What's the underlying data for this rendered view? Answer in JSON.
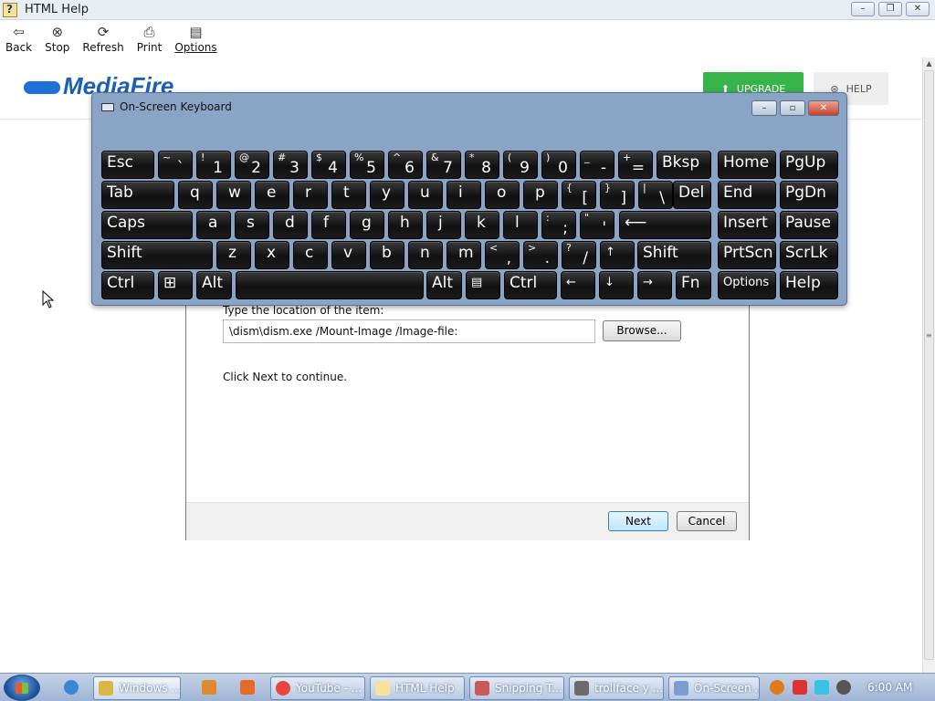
{
  "help_window": {
    "title": "HTML Help",
    "controls": [
      "–",
      "❐",
      "✕"
    ]
  },
  "toolbar": {
    "back": "Back",
    "stop": "Stop",
    "refresh": "Refresh",
    "print": "Print",
    "options": "Options"
  },
  "mediafire": {
    "logo_text": "MediaFire",
    "upgrade_label": "UPGRADE",
    "help_label": "HELP",
    "colors": {
      "brand": "#1c5fb5",
      "upgrade": "#37b34a"
    }
  },
  "wizard": {
    "prompt": "Type the location of the item:",
    "location_value": "\\dism\\dism.exe /Mount-Image /Image-file:",
    "browse_label": "Browse...",
    "continue_text": "Click Next to continue.",
    "next_label": "Next",
    "cancel_label": "Cancel"
  },
  "osk": {
    "title": "On-Screen Keyboard",
    "keys": {
      "esc": "Esc",
      "bksp": "Bksp",
      "home": "Home",
      "pgup": "PgUp",
      "tab": "Tab",
      "del": "Del",
      "end": "End",
      "pgdn": "PgDn",
      "caps": "Caps",
      "insert": "Insert",
      "pause": "Pause",
      "shift_left": "Shift",
      "shift_right": "Shift",
      "prtscn": "PrtScn",
      "scrlk": "ScrLk",
      "ctrl_left": "Ctrl",
      "alt_left": "Alt",
      "alt_right": "Alt",
      "ctrl_right": "Ctrl",
      "fn": "Fn",
      "options": "Options",
      "help": "Help"
    },
    "number_row": [
      {
        "s": "~",
        "b": "`"
      },
      {
        "s": "!",
        "b": "1"
      },
      {
        "s": "@",
        "b": "2"
      },
      {
        "s": "#",
        "b": "3"
      },
      {
        "s": "$",
        "b": "4"
      },
      {
        "s": "%",
        "b": "5"
      },
      {
        "s": "^",
        "b": "6"
      },
      {
        "s": "&",
        "b": "7"
      },
      {
        "s": "*",
        "b": "8"
      },
      {
        "s": "(",
        "b": "9"
      },
      {
        "s": ")",
        "b": "0"
      },
      {
        "s": "_",
        "b": "-"
      },
      {
        "s": "+",
        "b": "="
      }
    ],
    "row_q": [
      "q",
      "w",
      "e",
      "r",
      "t",
      "y",
      "u",
      "i",
      "o",
      "p"
    ],
    "row_q_symbols": [
      {
        "s": "{",
        "b": "["
      },
      {
        "s": "}",
        "b": "]"
      },
      {
        "s": "|",
        "b": "\\"
      }
    ],
    "row_a": [
      "a",
      "s",
      "d",
      "f",
      "g",
      "h",
      "j",
      "k",
      "l"
    ],
    "row_a_symbols": [
      {
        "s": ":",
        "b": ";"
      },
      {
        "s": "\"",
        "b": "'"
      }
    ],
    "row_z": [
      "z",
      "x",
      "c",
      "v",
      "b",
      "n",
      "m"
    ],
    "row_z_symbols": [
      {
        "s": "<",
        "b": ","
      },
      {
        "s": ">",
        "b": "."
      },
      {
        "s": "?",
        "b": "/"
      }
    ]
  },
  "taskbar": {
    "tasks": [
      {
        "label": "Windows ...",
        "color": "#d8b64a"
      },
      {
        "label": "YouTube - ...",
        "color": "#e8453c"
      },
      {
        "label": "HTML Help",
        "color": "#f6e39a"
      },
      {
        "label": "Snipping T...",
        "color": "#c85a5a"
      },
      {
        "label": "trollface y ...",
        "color": "#6b6b6b"
      },
      {
        "label": "On-Screen ...",
        "color": "#7a9ccf"
      }
    ],
    "clock": "6:00 AM"
  }
}
